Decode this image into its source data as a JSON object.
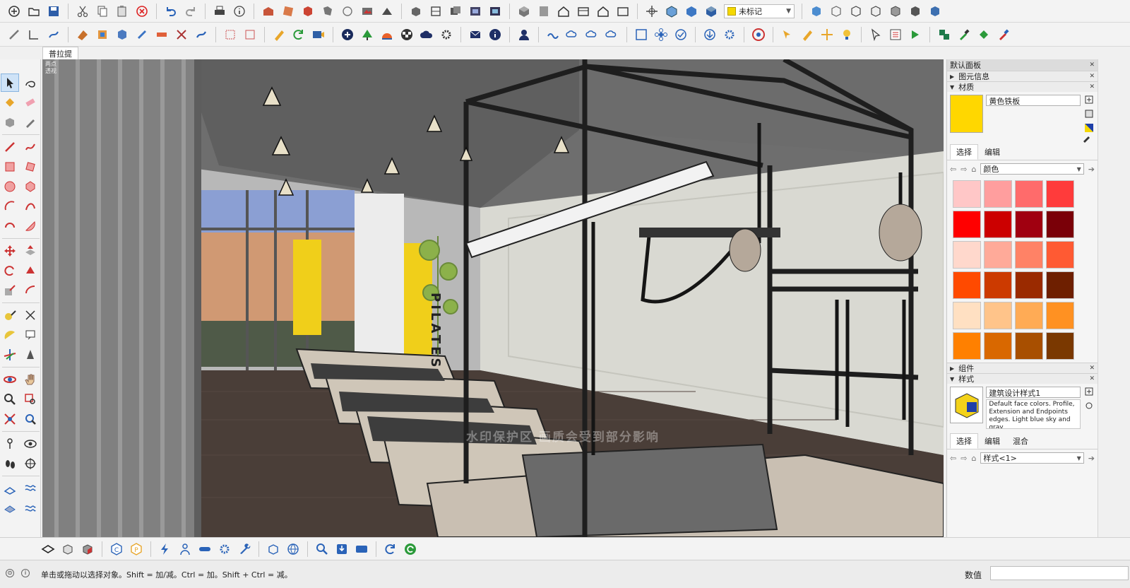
{
  "toolbar": {
    "tag_select": {
      "value": "未标记"
    }
  },
  "scene_tabs": [
    "普拉提"
  ],
  "viewport": {
    "label_lines": [
      "两点",
      "透视"
    ],
    "sign_text": "PILATES",
    "watermark": "水印保护区  画质会受到部分影响"
  },
  "tray": {
    "title": "默认面板",
    "sections": {
      "entity_info": "图元信息",
      "materials": "材质",
      "components": "组件",
      "styles": "样式"
    },
    "material": {
      "name": "黄色铁板",
      "color": "#FFD700",
      "tabs": [
        "选择",
        "编辑"
      ],
      "library": "颜色",
      "swatches": [
        "#ffc7c7",
        "#ff9e9e",
        "#ff6b6b",
        "#ff3b3b",
        "#ff0000",
        "#cc0000",
        "#a00010",
        "#7a0008",
        "#ffd8cc",
        "#ffaa99",
        "#ff8266",
        "#ff5a33",
        "#ff4a00",
        "#cc3a00",
        "#9a2a00",
        "#6e1f00",
        "#ffe0c2",
        "#ffc48a",
        "#ffab55",
        "#ff9122",
        "#ff8000",
        "#d96800",
        "#a84f00",
        "#7a3800"
      ]
    },
    "style": {
      "name": "建筑设计样式1",
      "description": "Default face colors. Profile, Extension and Endpoints edges. Light blue sky and gray",
      "tabs": [
        "选择",
        "编辑",
        "混合"
      ],
      "selected": "样式<1>"
    }
  },
  "status": {
    "text": "单击或拖动以选择对象。Shift = 加/减。Ctrl = 加。Shift + Ctrl = 减。",
    "measure_label": "数值",
    "measure_value": ""
  }
}
